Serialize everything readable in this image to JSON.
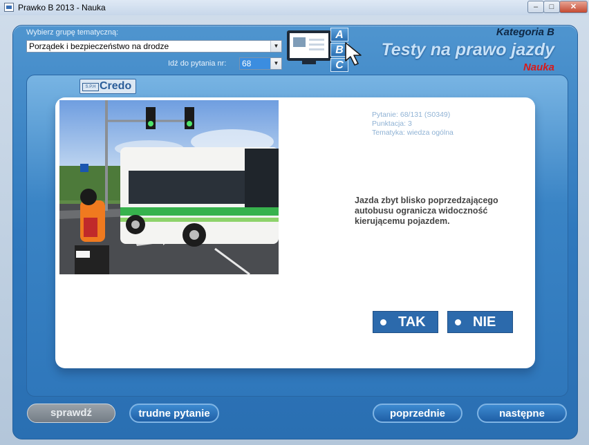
{
  "window": {
    "title": "Prawko B 2013 - Nauka"
  },
  "header": {
    "group_label": "Wybierz grupę tematyczną:",
    "group_value": "Porządek i bezpieczeństwo na drodze",
    "goto_label": "Idź do pytania nr:",
    "goto_value": "68",
    "abc": [
      "A",
      "B",
      "C"
    ],
    "category": "Kategoria B",
    "app_title": "Testy na prawo jazdy",
    "mode": "Nauka"
  },
  "sponsor": {
    "sph": "S.P.H",
    "name": "Credo"
  },
  "question": {
    "number_line": "Pytanie: 68/131 (S0349)",
    "points_line": "Punktacja: 3",
    "topic_line": "Tematyka: wiedza ogólna",
    "text": "Jazda zbyt blisko poprzedzającego autobusu ogranicza widoczność kierującemu pojazdem."
  },
  "answers": {
    "yes": "TAK",
    "no": "NIE"
  },
  "footer": {
    "check": "sprawdź",
    "hard": "trudne pytanie",
    "prev": "poprzednie",
    "next": "następne"
  }
}
